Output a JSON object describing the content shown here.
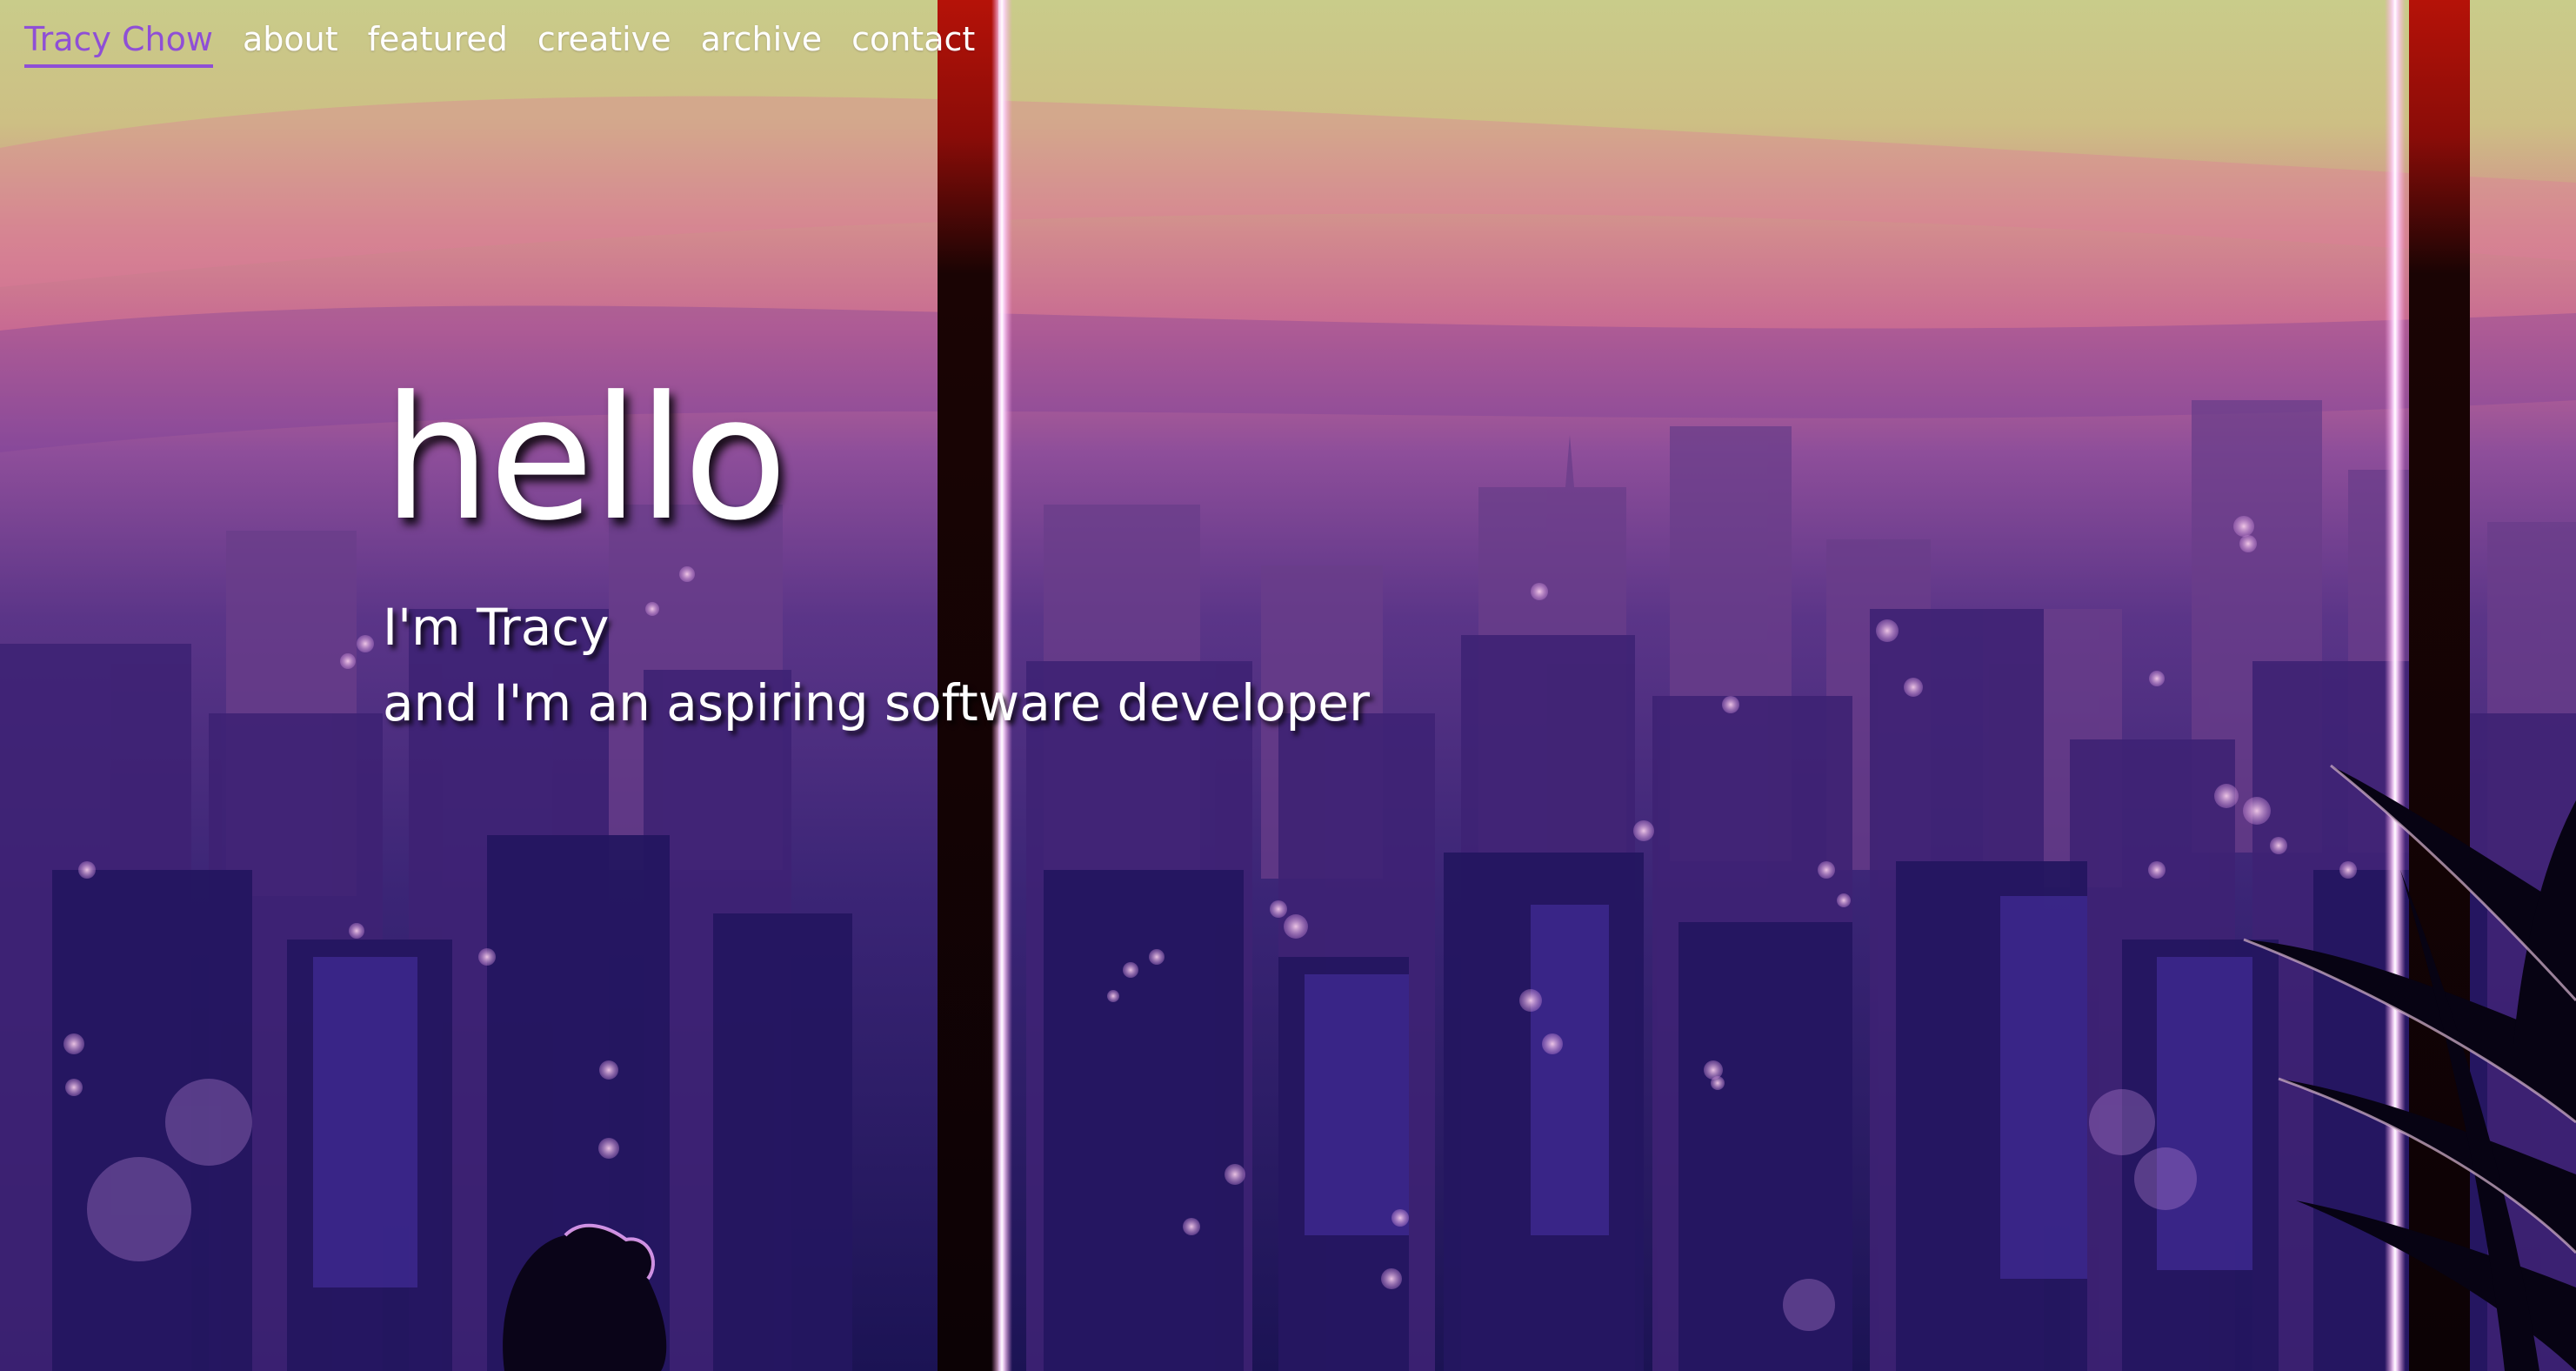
{
  "nav": {
    "items": [
      {
        "label": "Tracy Chow",
        "active": true
      },
      {
        "label": "about",
        "active": false
      },
      {
        "label": "featured",
        "active": false
      },
      {
        "label": "creative",
        "active": false
      },
      {
        "label": "archive",
        "active": false
      },
      {
        "label": "contact",
        "active": false
      }
    ]
  },
  "hero": {
    "heading": "hello",
    "line1": "I'm Tracy",
    "line2": "and I'm an aspiring software developer"
  },
  "colors": {
    "nav_active": "#8f4fd6",
    "text": "#ffffff",
    "sky_top": "#c9cc8a",
    "sky_pink": "#d06a8c",
    "city_purple": "#4b2f8a",
    "city_deep": "#1c1450",
    "window_frame": "#140606",
    "frame_glow": "#ffe6ff"
  }
}
